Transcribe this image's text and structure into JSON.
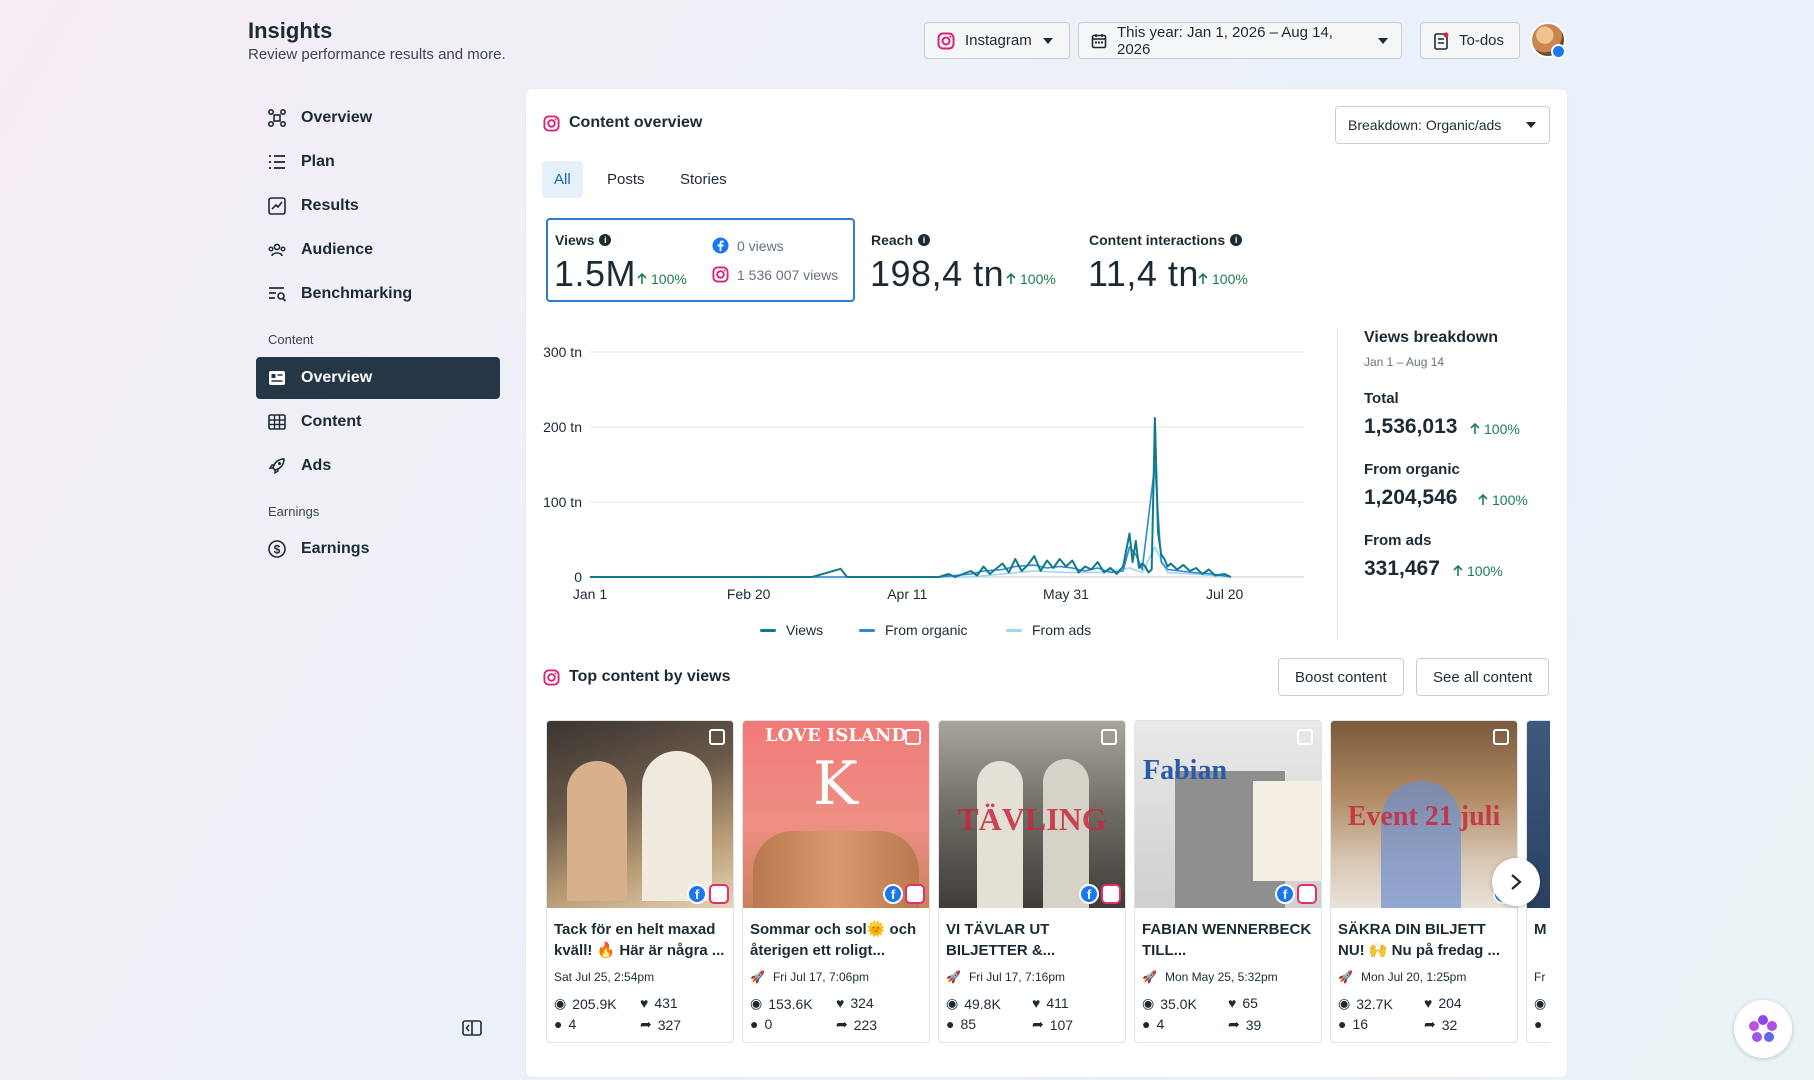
{
  "header": {
    "title": "Insights",
    "subtitle": "Review performance results and more.",
    "platform": "Instagram",
    "date_range": "This year: Jan 1, 2026 – Aug 14, 2026",
    "todos": "To-dos"
  },
  "sidebar": {
    "items": [
      {
        "label": "Overview",
        "icon": "overview-icon"
      },
      {
        "label": "Plan",
        "icon": "list-icon"
      },
      {
        "label": "Results",
        "icon": "trend-icon"
      },
      {
        "label": "Audience",
        "icon": "people-icon"
      },
      {
        "label": "Benchmarking",
        "icon": "benchmark-icon"
      }
    ],
    "section_content": "Content",
    "content_items": [
      {
        "label": "Overview",
        "icon": "overview-card-icon",
        "active": true
      },
      {
        "label": "Content",
        "icon": "table-icon"
      },
      {
        "label": "Ads",
        "icon": "rocket-icon"
      }
    ],
    "section_earnings": "Earnings",
    "earnings_items": [
      {
        "label": "Earnings",
        "icon": "dollar-icon"
      }
    ]
  },
  "overview": {
    "title": "Content overview",
    "breakdown": "Breakdown: Organic/ads",
    "tabs": [
      "All",
      "Posts",
      "Stories"
    ],
    "metrics": {
      "views": {
        "label": "Views",
        "value": "1.5M",
        "change": "100%",
        "fb": "0 views",
        "ig": "1 536 007 views"
      },
      "reach": {
        "label": "Reach",
        "value": "198,4 tn",
        "change": "100%"
      },
      "interactions": {
        "label": "Content interactions",
        "value": "11,4 tn",
        "change": "100%"
      }
    }
  },
  "chart_data": {
    "type": "line",
    "x_labels": [
      "Jan 1",
      "Feb 20",
      "Apr 11",
      "May 31",
      "Jul 20"
    ],
    "y_ticks": [
      "0",
      "100 tn",
      "200 tn",
      "300 tn"
    ],
    "ylim": [
      0,
      300000
    ],
    "grid": true,
    "legend_position": "bottom",
    "series": [
      {
        "name": "Views",
        "color": "#107a8b",
        "points": [
          [
            0,
            0
          ],
          [
            40,
            0
          ],
          [
            70,
            0
          ],
          [
            79,
            11000
          ],
          [
            81,
            0
          ],
          [
            110,
            0
          ],
          [
            113,
            4000
          ],
          [
            115,
            0
          ],
          [
            120,
            8000
          ],
          [
            122,
            2000
          ],
          [
            124,
            14000
          ],
          [
            126,
            4000
          ],
          [
            130,
            18000
          ],
          [
            132,
            6000
          ],
          [
            134,
            24000
          ],
          [
            136,
            8000
          ],
          [
            138,
            16000
          ],
          [
            140,
            28000
          ],
          [
            142,
            8000
          ],
          [
            144,
            22000
          ],
          [
            146,
            12000
          ],
          [
            148,
            24000
          ],
          [
            150,
            14000
          ],
          [
            152,
            22000
          ],
          [
            154,
            6000
          ],
          [
            156,
            14000
          ],
          [
            158,
            10000
          ],
          [
            160,
            20000
          ],
          [
            162,
            6000
          ],
          [
            164,
            12000
          ],
          [
            166,
            4000
          ],
          [
            168,
            14000
          ],
          [
            170,
            58000
          ],
          [
            171,
            20000
          ],
          [
            172,
            48000
          ],
          [
            173,
            12000
          ],
          [
            174,
            18000
          ],
          [
            175,
            14000
          ],
          [
            176,
            6000
          ],
          [
            177,
            10000
          ],
          [
            178,
            212000
          ],
          [
            179,
            60000
          ],
          [
            180,
            30000
          ],
          [
            181,
            24000
          ],
          [
            182,
            14000
          ],
          [
            183,
            18000
          ],
          [
            185,
            10000
          ],
          [
            187,
            16000
          ],
          [
            189,
            8000
          ],
          [
            191,
            12000
          ],
          [
            193,
            4000
          ],
          [
            195,
            10000
          ],
          [
            197,
            2000
          ],
          [
            200,
            4000
          ],
          [
            202,
            0
          ]
        ]
      },
      {
        "name": "From organic",
        "color": "#2d88d8",
        "points": [
          [
            0,
            0
          ],
          [
            110,
            0
          ],
          [
            120,
            4000
          ],
          [
            124,
            8000
          ],
          [
            130,
            10000
          ],
          [
            134,
            14000
          ],
          [
            140,
            16000
          ],
          [
            144,
            12000
          ],
          [
            148,
            14000
          ],
          [
            152,
            12000
          ],
          [
            156,
            8000
          ],
          [
            160,
            12000
          ],
          [
            164,
            6000
          ],
          [
            168,
            8000
          ],
          [
            170,
            40000
          ],
          [
            172,
            30000
          ],
          [
            174,
            10000
          ],
          [
            178,
            150000
          ],
          [
            180,
            20000
          ],
          [
            182,
            10000
          ],
          [
            186,
            8000
          ],
          [
            190,
            6000
          ],
          [
            196,
            4000
          ],
          [
            202,
            0
          ]
        ]
      },
      {
        "name": "From ads",
        "color": "#9fd4f5",
        "points": [
          [
            0,
            0
          ],
          [
            120,
            0
          ],
          [
            130,
            4000
          ],
          [
            140,
            8000
          ],
          [
            150,
            6000
          ],
          [
            160,
            6000
          ],
          [
            170,
            12000
          ],
          [
            174,
            6000
          ],
          [
            178,
            40000
          ],
          [
            182,
            6000
          ],
          [
            190,
            4000
          ],
          [
            202,
            0
          ]
        ]
      }
    ],
    "x_domain": [
      0,
      225
    ]
  },
  "breakdown": {
    "title": "Views breakdown",
    "date": "Jan 1 – Aug 14",
    "total_label": "Total",
    "total": "1,536,013",
    "total_change": "100%",
    "organic_label": "From organic",
    "organic": "1,204,546",
    "organic_change": "100%",
    "ads_label": "From ads",
    "ads": "331,467",
    "ads_change": "100%"
  },
  "top_content": {
    "title": "Top content by views",
    "boost": "Boost content",
    "see_all": "See all content",
    "posts": [
      {
        "caption": "Tack för en helt maxad kväll! 🔥 Här är några ...",
        "date": "Sat Jul 25, 2:54pm",
        "type": "carousel",
        "views": "205.9K",
        "likes": "431",
        "comments": "4",
        "shares": "327",
        "thumb_text": "",
        "thumb_overlay": ""
      },
      {
        "caption": "Sommar och sol🌞 och återigen ett roligt...",
        "date": "Fri Jul 17, 7:06pm",
        "type": "boosted",
        "views": "153.6K",
        "likes": "324",
        "comments": "0",
        "shares": "223",
        "thumb_text": "LOVE ISLAND",
        "thumb_overlay": ""
      },
      {
        "caption": "VI TÄVLAR UT BILJETTER &...",
        "date": "Fri Jul 17, 7:16pm",
        "type": "boosted",
        "views": "49.8K",
        "likes": "411",
        "comments": "85",
        "shares": "107",
        "thumb_text": "",
        "thumb_overlay": "TÄVLING"
      },
      {
        "caption": "FABIAN WENNERBECK TILL...",
        "date": "Mon May 25, 5:32pm",
        "type": "boosted",
        "views": "35.0K",
        "likes": "65",
        "comments": "4",
        "shares": "39",
        "thumb_text": "Fabian",
        "thumb_overlay": ""
      },
      {
        "caption": "SÄKRA DIN BILJETT NU! 🙌 Nu på fredag ...",
        "date": "Mon Jul 20, 1:25pm",
        "type": "boosted",
        "views": "32.7K",
        "likes": "204",
        "comments": "16",
        "shares": "32",
        "thumb_text": "",
        "thumb_overlay": "Event 21 juli"
      },
      {
        "caption": "M B",
        "date": "Fr",
        "type": "boosted",
        "views": "",
        "likes": "",
        "comments": "",
        "shares": "",
        "thumb_text": "",
        "thumb_overlay": ""
      }
    ]
  },
  "colors": {
    "accent": "#0a6bc2",
    "positive": "#1a7f4b",
    "sidebar_active": "#253746"
  }
}
